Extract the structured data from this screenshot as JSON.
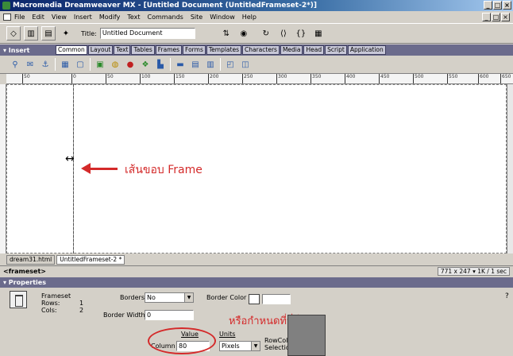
{
  "window": {
    "title": "Macromedia Dreamweaver MX - [Untitled Document (UntitledFrameset-2*)]",
    "buttons": [
      "_",
      "□",
      "×"
    ]
  },
  "menu": [
    "File",
    "Edit",
    "View",
    "Insert",
    "Modify",
    "Text",
    "Commands",
    "Site",
    "Window",
    "Help"
  ],
  "toolbar": {
    "title_label": "Title:",
    "title_value": "Untitled Document"
  },
  "insert": {
    "title": "▾ Insert",
    "tabs": [
      "Common",
      "Layout",
      "Text",
      "Tables",
      "Frames",
      "Forms",
      "Templates",
      "Characters",
      "Media",
      "Head",
      "Script",
      "Application"
    ]
  },
  "ruler": {
    "ticks": [
      "50",
      "0",
      "50",
      "100",
      "150",
      "200",
      "250",
      "300",
      "350",
      "400",
      "450",
      "500",
      "550",
      "600",
      "650"
    ]
  },
  "document": {
    "annotation": "เส้นขอบ Frame",
    "cursor": "↔"
  },
  "doctabs": [
    "dream31.html",
    "UntitledFrameset-2 *"
  ],
  "status": {
    "tag": "<frameset>",
    "size": "771 x 247 ▾ 1K / 1 sec"
  },
  "properties": {
    "title": "▾ Properties",
    "frameset_label": "Frameset",
    "rows_label": "Rows:",
    "rows_value": "1",
    "cols_label": "Cols:",
    "cols_value": "2",
    "borders_label": "Borders",
    "borders_value": "No",
    "border_color_label": "Border Color",
    "border_width_label": "Border Width",
    "border_width_value": "0",
    "value_label": "Value",
    "units_label": "Units",
    "column_label": "Column",
    "column_value": "80",
    "units_value": "Pixels",
    "rowcol_label": "RowCol Selection",
    "annotation": "หรือกำหนดที่นี่ก็ได้"
  },
  "colors": {
    "annotation": "#d42a2a",
    "panel_header": "#6b6b8c",
    "titlebar": "#0a246a"
  }
}
